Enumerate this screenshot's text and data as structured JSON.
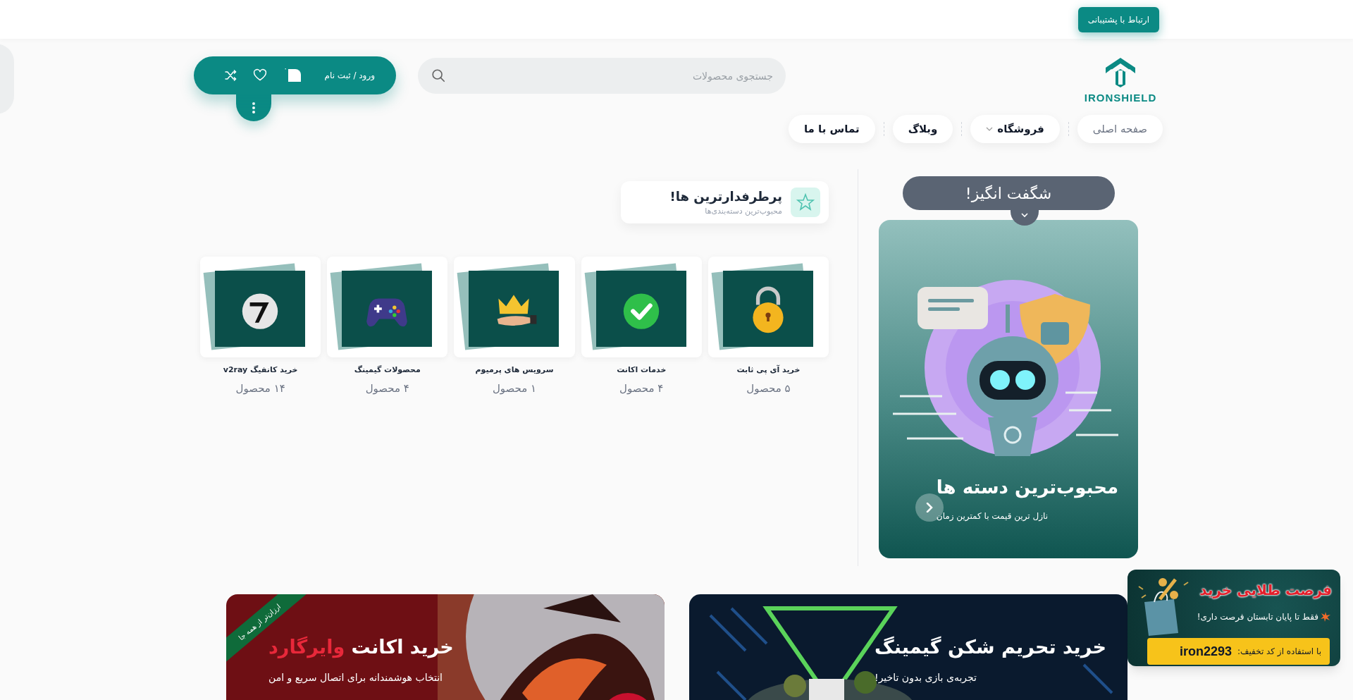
{
  "top_bar": {
    "support_button": "ارتباط با پشتیبانی"
  },
  "header": {
    "logo_text": "IRONSHIELD",
    "search": {
      "placeholder": "جستجوی محصولات"
    },
    "account": {
      "login": "ورود / ثبت نام",
      "cart_count": "۰"
    }
  },
  "nav": [
    {
      "label": "صفحه اصلی",
      "selected": true,
      "dropdown": false
    },
    {
      "label": "فروشگاه",
      "selected": false,
      "dropdown": true
    },
    {
      "label": "وبلاگ",
      "selected": false,
      "dropdown": false
    },
    {
      "label": "تماس با ما",
      "selected": false,
      "dropdown": false
    }
  ],
  "promo": {
    "heading": "شگفت انگیز!",
    "title": "محبوب‌ترین دسته ها",
    "subtitle": "نازل ترین قیمت با کمترین زمان"
  },
  "categories": {
    "title": "پرطرفدارترین ها!",
    "subtitle": "محبوب‌ترین دسته‌بندی‌ها",
    "items": [
      {
        "name": "خرید آی پی ثابت",
        "count": "۵ محصول"
      },
      {
        "name": "خدمات اکانت",
        "count": "۴ محصول"
      },
      {
        "name": "سرویس های پرمیوم",
        "count": "۱ محصول"
      },
      {
        "name": "محصولات گیمینگ",
        "count": "۴ محصول"
      },
      {
        "name": "خرید کانفیگ v2ray",
        "count": "۱۴ محصول"
      }
    ]
  },
  "banners": [
    {
      "title": "خرید تحریم شکن گیمینگ",
      "subtitle": "تجربه‌ی بازی بدون تاخیر!"
    },
    {
      "ribbon": "ارزان‌تر از همه جا",
      "title": "خرید اکانت ",
      "title_highlight": "وایرگارد",
      "subtitle": "انتخاب هوشمندانه برای اتصال سریع و امن"
    }
  ],
  "offer_popup": {
    "title": "فرصت طلایی خرید",
    "text": "فقط تا پایان تابستان فرصت داری!",
    "code_label": "با استفاده از کد تخفیف:",
    "code": "iron2293"
  }
}
